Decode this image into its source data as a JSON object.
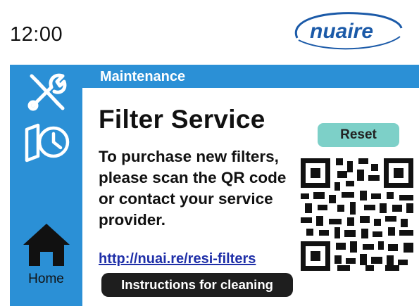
{
  "status": {
    "time": "12:00"
  },
  "brand": {
    "logo_text": "nuaire"
  },
  "sidebar": {
    "items": [
      {
        "icon": "tools-icon"
      },
      {
        "icon": "schedule-icon"
      },
      {
        "icon": "home-icon",
        "label": "Home"
      }
    ]
  },
  "screen": {
    "header": "Maintenance",
    "title": "Filter Service",
    "description": "To purchase new filters, please scan the QR code or contact your service provider.",
    "link": "http://nuai.re/resi-filters",
    "reset_label": "Reset",
    "instructions_label": "Instructions for cleaning"
  },
  "colors": {
    "accent": "#2b90d6",
    "reset_button": "#7dd0c8",
    "instructions_button": "#1e1e1e",
    "link": "#1f2fa8",
    "logo": "#1b5aa8"
  }
}
